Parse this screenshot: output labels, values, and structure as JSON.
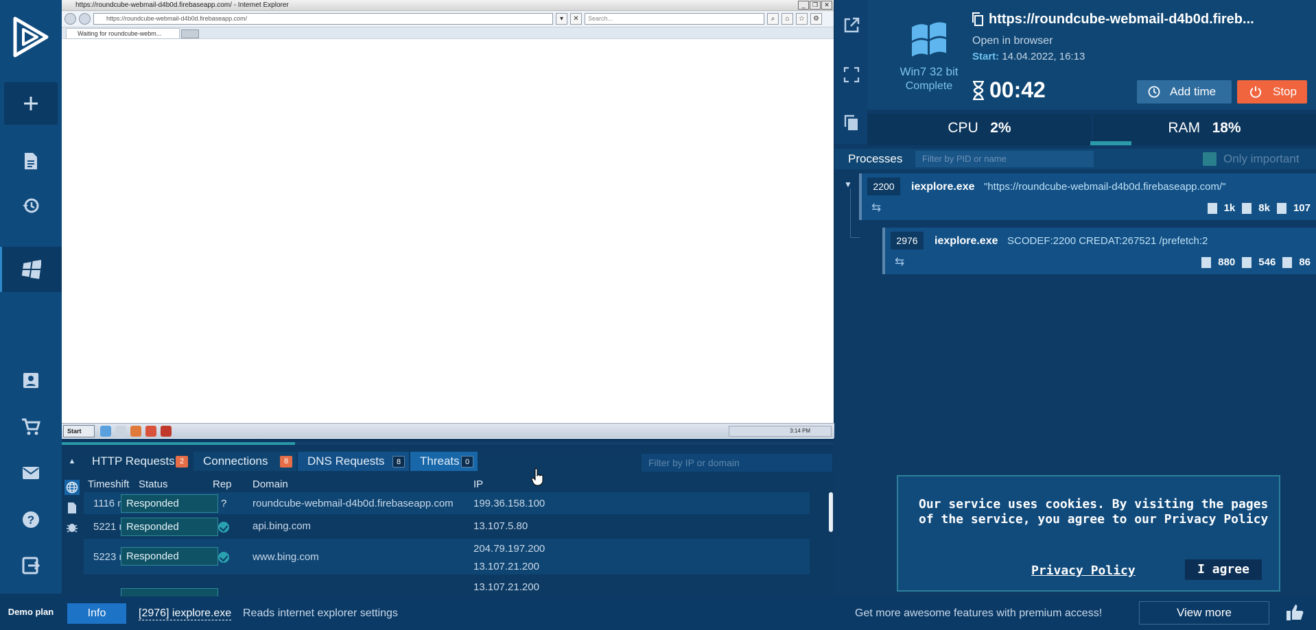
{
  "vm": {
    "ie_title": "https://roundcube-webmail-d4b0d.firebaseapp.com/ - Internet Explorer",
    "address": "https://roundcube-webmail-d4b0d.firebaseapp.com/",
    "search_placeholder": "Search...",
    "tab_label": "Waiting for roundcube-webm...",
    "start": "Start",
    "clock": "3:14 PM"
  },
  "sidebar": {
    "demo_plan": "Demo plan"
  },
  "net": {
    "tabs": [
      {
        "label": "HTTP Requests",
        "count": "2"
      },
      {
        "label": "Connections",
        "count": "8"
      },
      {
        "label": "DNS Requests",
        "count": "8"
      },
      {
        "label": "Threats",
        "count": "0"
      }
    ],
    "filter_placeholder": "Filter by IP or domain",
    "headers": {
      "timeshift": "Timeshift",
      "status": "Status",
      "rep": "Rep",
      "domain": "Domain",
      "ip": "IP"
    },
    "rows": [
      {
        "time": "1116 ms",
        "status": "Responded",
        "rep": "?",
        "domain": "roundcube-webmail-d4b0d.firebaseapp.com",
        "ip": "199.36.158.100",
        "ip2": ""
      },
      {
        "time": "5221 ms",
        "status": "Responded",
        "rep": "check",
        "domain": "api.bing.com",
        "ip": "13.107.5.80",
        "ip2": ""
      },
      {
        "time": "5223 ms",
        "status": "Responded",
        "rep": "check",
        "domain": "www.bing.com",
        "ip": "204.79.197.200",
        "ip2": "13.107.21.200"
      },
      {
        "time": "",
        "status": "",
        "rep": "",
        "domain": "",
        "ip": "13.107.21.200",
        "ip2": ""
      }
    ]
  },
  "right": {
    "os_name": "Win7 32 bit",
    "os_status": "Complete",
    "url_title": "https://roundcube-webmail-d4b0d.fireb...",
    "open_in_browser": "Open in browser",
    "start_label": "Start:",
    "start_value": "14.04.2022, 16:13",
    "timer": "00:42",
    "add_time": "Add time",
    "stop": "Stop",
    "cpu_label": "CPU",
    "cpu_value": "2%",
    "ram_label": "RAM",
    "ram_value": "18%",
    "processes_label": "Processes",
    "pid_filter_placeholder": "Filter by PID or name",
    "only_important": "Only important",
    "processes": [
      {
        "pid": "2200",
        "name": "iexplore.exe",
        "args": "\"https://roundcube-webmail-d4b0d.firebaseapp.com/\"",
        "files": "1k",
        "reg": "8k",
        "mods": "107"
      },
      {
        "pid": "2976",
        "name": "iexplore.exe",
        "args": "SCODEF:2200 CREDAT:267521 /prefetch:2",
        "files": "880",
        "reg": "546",
        "mods": "86"
      }
    ]
  },
  "cookie": {
    "text": "Our service uses cookies. By visiting the pages of the service, you agree to our Privacy Policy",
    "privacy_link": "Privacy Policy",
    "agree": "I agree"
  },
  "bottom": {
    "info": "Info",
    "process_ref": "[2976] iexplore.exe",
    "message": "Reads internet explorer settings",
    "premium": "Get more awesome features with premium access!",
    "view_more": "View more"
  },
  "colors": {
    "accent": "#2a9aa8",
    "stop": "#f0643e",
    "badge": "#e56e48"
  }
}
